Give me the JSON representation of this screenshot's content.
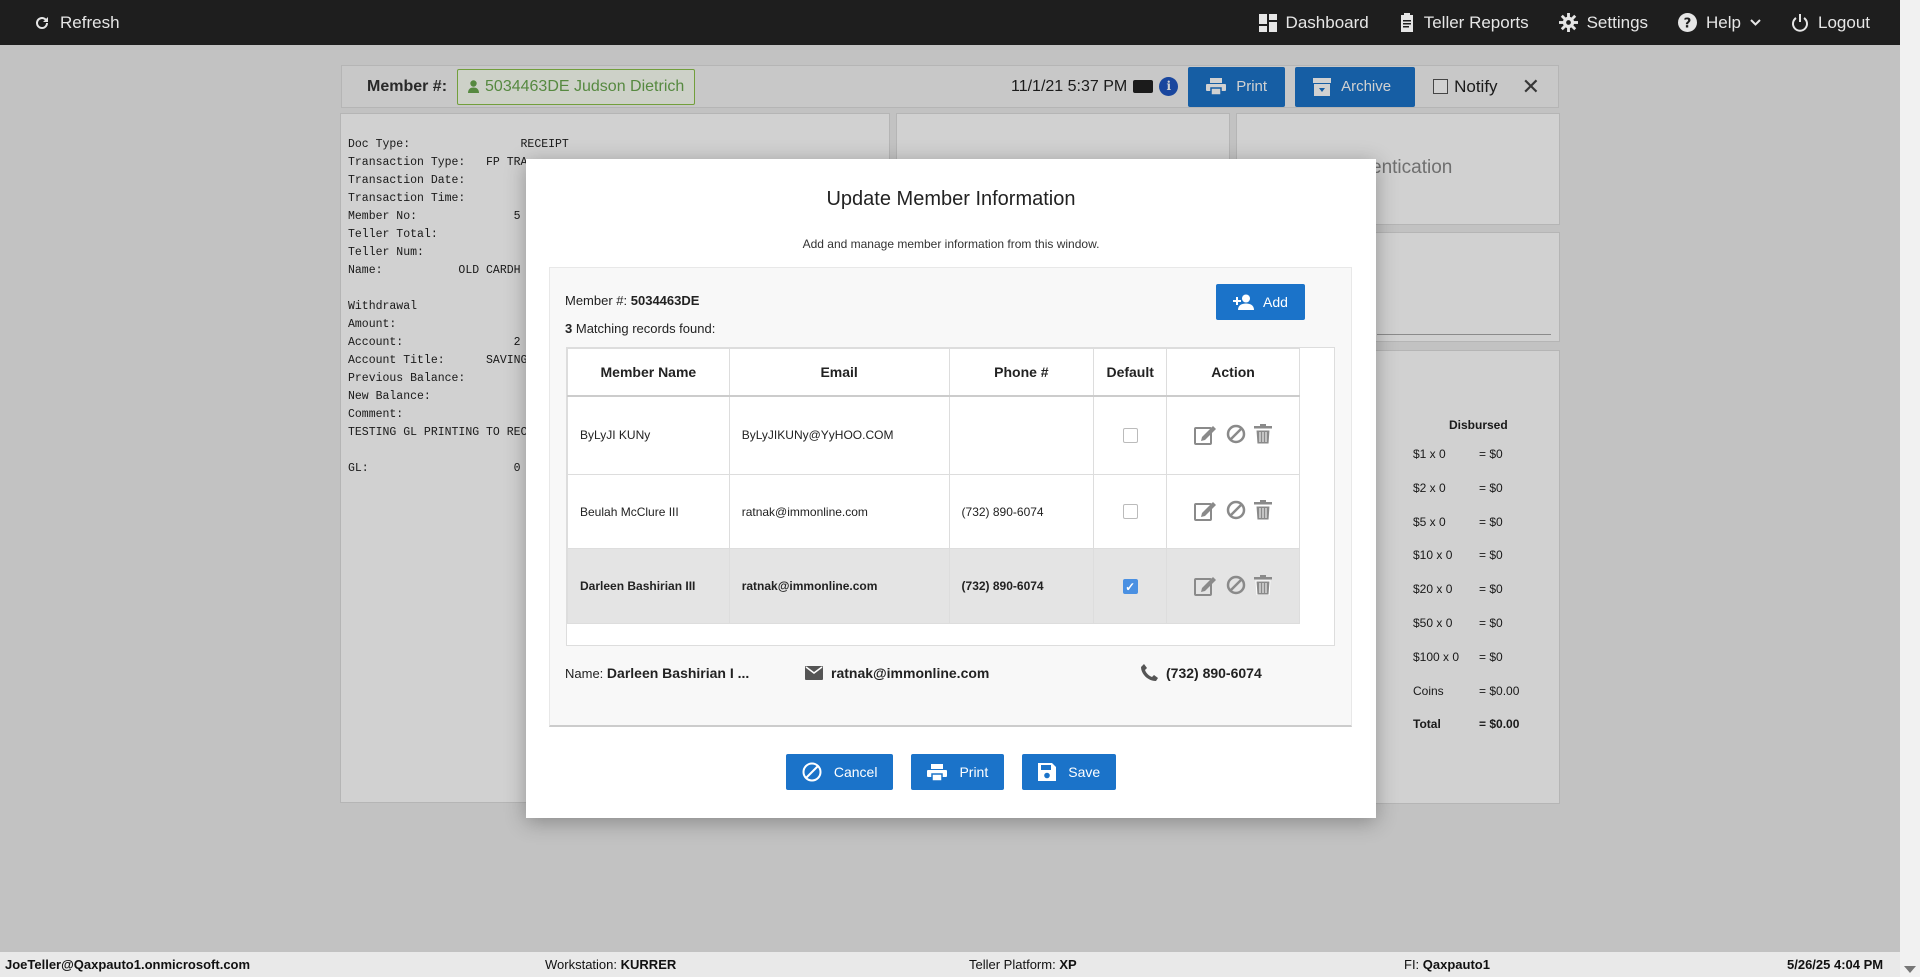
{
  "topbar": {
    "refresh": "Refresh",
    "nav": [
      "Dashboard",
      "Teller Reports",
      "Settings",
      "Help",
      "Logout"
    ]
  },
  "page": {
    "member_label": "Member #:",
    "member_chip": "5034463DE Judson Dietrich",
    "datetime": "11/1/21 5:37 PM",
    "print": "Print",
    "archive": "Archive",
    "notify": "Notify",
    "auth_panel_text": "entication",
    "receipt_lines": [
      "Doc Type:                RECEIPT",
      "Transaction Type:   FP TRA",
      "Transaction Date:",
      "Transaction Time:",
      "Member No:              5",
      "Teller Total:",
      "Teller Num:",
      "Name:           OLD CARDH",
      "",
      "Withdrawal",
      "Amount:",
      "Account:                2",
      "Account Title:      SAVINGS",
      "Previous Balance:",
      "New Balance:",
      "Comment:",
      "TESTING GL PRINTING TO RECE",
      "",
      "GL:                     0"
    ],
    "disbursed": {
      "header": "Disbursed",
      "rows": [
        {
          "label": "$1 x 0",
          "value": "= $0"
        },
        {
          "label": "$2 x 0",
          "value": "= $0"
        },
        {
          "label": "$5 x 0",
          "value": "= $0"
        },
        {
          "label": "$10 x 0",
          "value": "= $0"
        },
        {
          "label": "$20 x 0",
          "value": "= $0"
        },
        {
          "label": "$50 x 0",
          "value": "= $0"
        },
        {
          "label": "$100 x 0",
          "value": "= $0"
        },
        {
          "label": "Coins",
          "value": "= $0.00"
        },
        {
          "label": "Total",
          "value": "= $0.00"
        }
      ]
    }
  },
  "modal": {
    "title": "Update Member Information",
    "subtitle": "Add and manage member information from this window.",
    "member_label": "Member #:",
    "member_no": "5034463DE",
    "match_count": "3",
    "match_text": "Matching records found:",
    "add": "Add",
    "columns": [
      "Member Name",
      "Email",
      "Phone #",
      "Default",
      "Action"
    ],
    "rows": [
      {
        "name": "ByLyJI KUNy",
        "email": "ByLyJIKUNy@YyHOO.COM",
        "phone": "",
        "default": false
      },
      {
        "name": "Beulah McClure III",
        "email": "ratnak@immonline.com",
        "phone": "(732) 890-6074",
        "default": false
      },
      {
        "name": "Darleen Bashirian III",
        "email": "ratnak@immonline.com",
        "phone": "(732) 890-6074",
        "default": true
      }
    ],
    "summary": {
      "name_label": "Name:",
      "name": "Darleen Bashirian I ...",
      "email": "ratnak@immonline.com",
      "phone": "(732) 890-6074"
    },
    "buttons": {
      "cancel": "Cancel",
      "print": "Print",
      "save": "Save"
    }
  },
  "status": {
    "user": "JoeTeller@Qaxpauto1.onmicrosoft.com",
    "workstation_label": "Workstation:",
    "workstation": "KURRER",
    "platform_label": "Teller Platform:",
    "platform": "XP",
    "fi_label": "FI:",
    "fi": "Qaxpauto1",
    "datetime": "5/26/25 4:04 PM"
  },
  "colors": {
    "accent": "#1b73c9",
    "topbar": "#1e1e1e",
    "member_chip": "#6aa84f"
  }
}
